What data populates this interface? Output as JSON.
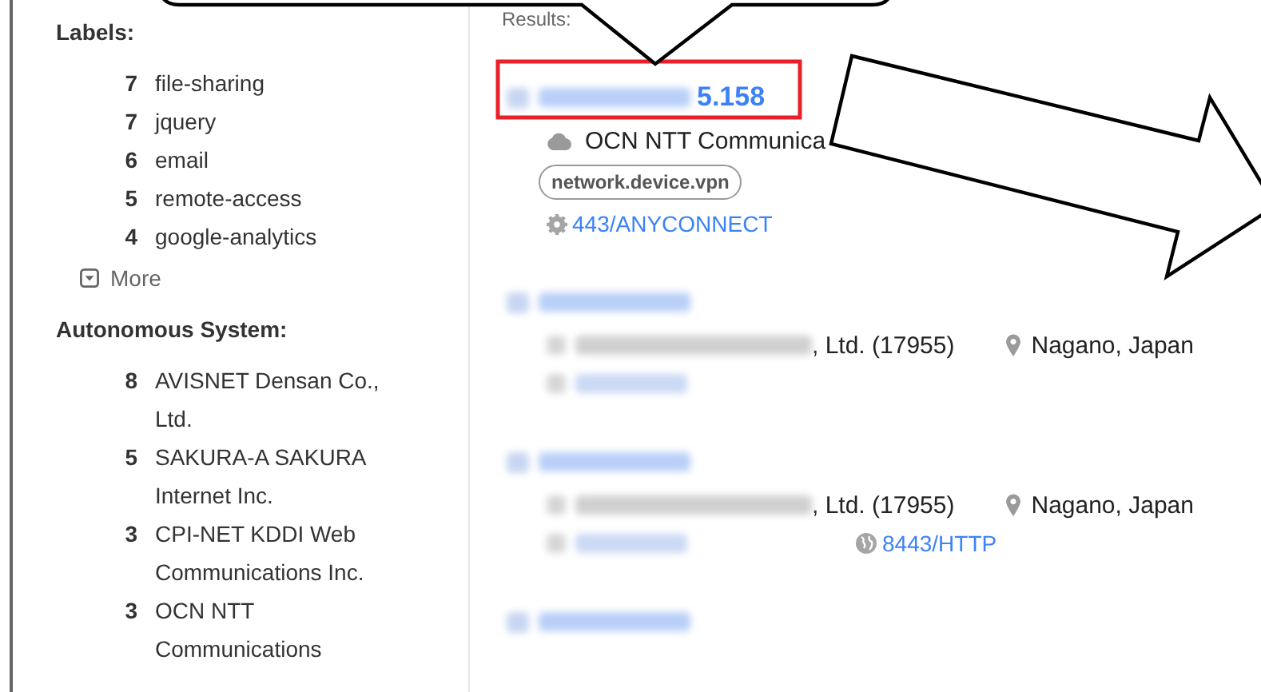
{
  "sidebar": {
    "sections": [
      {
        "title": "Labels:",
        "items": [
          {
            "count": "7",
            "label": "file-sharing"
          },
          {
            "count": "7",
            "label": "jquery"
          },
          {
            "count": "6",
            "label": "email"
          },
          {
            "count": "5",
            "label": "remote-access"
          },
          {
            "count": "4",
            "label": "google-analytics"
          }
        ],
        "more": "More"
      },
      {
        "title": "Autonomous System:",
        "items": [
          {
            "count": "8",
            "label": "AVISNET Densan Co., Ltd."
          },
          {
            "count": "5",
            "label": "SAKURA-A SAKURA Internet Inc."
          },
          {
            "count": "3",
            "label": "CPI-NET KDDI Web Communications Inc."
          },
          {
            "count": "3",
            "label": "OCN NTT Communications"
          }
        ]
      }
    ]
  },
  "results_label": "Results:",
  "results": [
    {
      "kind": "redacted",
      "ip": "5.158",
      "org": {
        "kind": "cloud",
        "text": "OCN NTT Communica"
      },
      "tags": [
        "network.device.vpn"
      ],
      "ports": [
        {
          "kind": "gear",
          "label": "443/ANYCONNECT"
        }
      ]
    },
    {
      "kind": "redacted",
      "org": {
        "kind": "redacted",
        "text": ", Ltd. (17955)"
      },
      "location": "Nagano, Japan",
      "ports": [
        {
          "kind": "redacted"
        }
      ]
    },
    {
      "kind": "redacted",
      "org": {
        "kind": "redacted",
        "text": ", Ltd. (17955)"
      },
      "location": "Nagano, Japan",
      "ports": [
        {
          "kind": "redacted"
        },
        {
          "kind": "globe",
          "label": "8443/HTTP"
        }
      ]
    },
    {
      "kind": "redacted"
    }
  ],
  "annotations": {
    "callout": true,
    "highlight": true,
    "arrow": true
  }
}
